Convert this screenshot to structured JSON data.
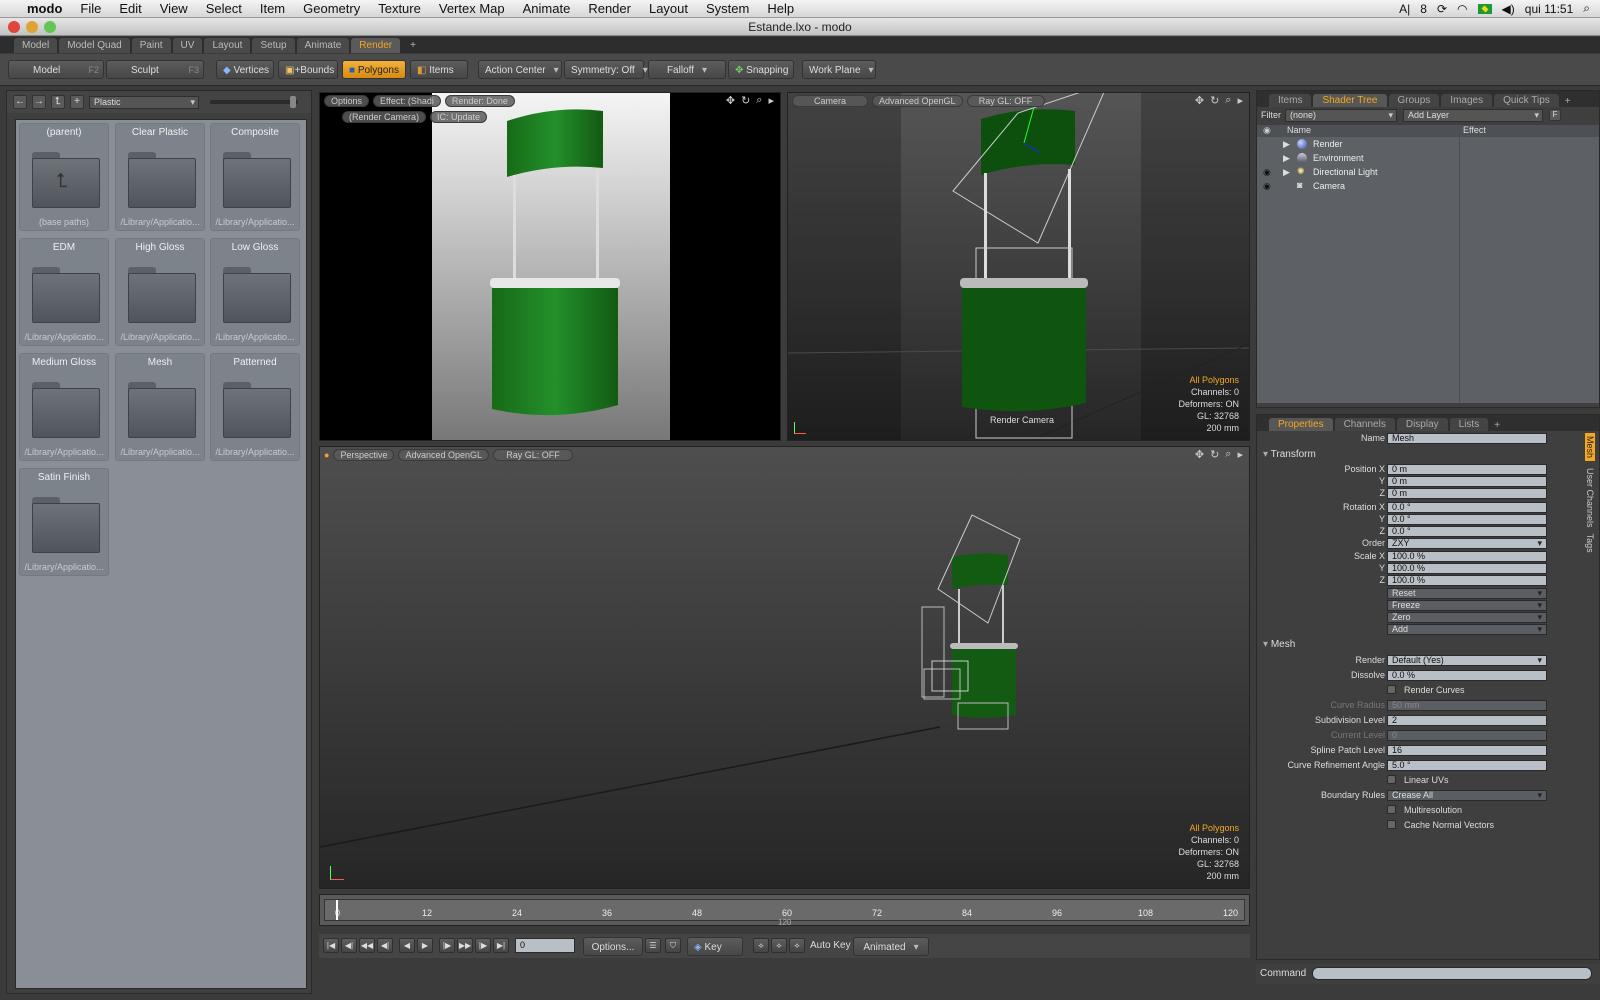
{
  "menubar": {
    "app": "modo",
    "items": [
      "File",
      "Edit",
      "View",
      "Select",
      "Item",
      "Geometry",
      "Texture",
      "Vertex Map",
      "Animate",
      "Render",
      "Layout",
      "System",
      "Help"
    ],
    "status": {
      "battery_num": "8",
      "clock": "qui 11:51"
    }
  },
  "window": {
    "title": "Estande.lxo - modo"
  },
  "layout_tabs": [
    "Model",
    "Model Quad",
    "Paint",
    "UV",
    "Layout",
    "Setup",
    "Animate",
    "Render"
  ],
  "toolbar": {
    "model": "Model",
    "model_key": "F2",
    "sculpt": "Sculpt",
    "sculpt_key": "F3",
    "vertices": "Vertices",
    "bounds": "+Bounds",
    "polygons": "Polygons",
    "items": "Items",
    "action_center": "Action Center",
    "symmetry": "Symmetry: Off",
    "falloff": "Falloff",
    "snapping": "Snapping",
    "work_plane": "Work Plane"
  },
  "presets": {
    "category": "Plastic",
    "tiles": [
      {
        "title": "(parent)",
        "path": "(base paths)"
      },
      {
        "title": "Clear Plastic",
        "path": "/Library/Applicatio..."
      },
      {
        "title": "Composite",
        "path": "/Library/Applicatio..."
      },
      {
        "title": "EDM",
        "path": "/Library/Applicatio..."
      },
      {
        "title": "High Gloss",
        "path": "/Library/Applicatio..."
      },
      {
        "title": "Low Gloss",
        "path": "/Library/Applicatio..."
      },
      {
        "title": "Medium Gloss",
        "path": "/Library/Applicatio..."
      },
      {
        "title": "Mesh",
        "path": "/Library/Applicatio..."
      },
      {
        "title": "Patterned",
        "path": "/Library/Applicatio..."
      },
      {
        "title": "Satin Finish",
        "path": "/Library/Applicatio..."
      }
    ]
  },
  "render_view": {
    "options": "Options",
    "effect": "Effect: (Shadi",
    "render_done": "Render: Done",
    "render_camera": "(Render Camera)",
    "ic_update": "IC: Update"
  },
  "camera_view": {
    "camera": "Camera",
    "opengl": "Advanced OpenGL",
    "raygl": "Ray GL: OFF",
    "cam_label": "Render Camera"
  },
  "persp_view": {
    "mode": "Perspective",
    "opengl": "Advanced OpenGL",
    "raygl": "Ray GL: OFF"
  },
  "stats": {
    "polys": "All Polygons",
    "channels": "Channels: 0",
    "deformers": "Deformers: ON",
    "gl": "GL: 32768",
    "size": "200 mm"
  },
  "shader_panel": {
    "tabs": [
      "Items",
      "Shader Tree",
      "Groups",
      "Images",
      "Quick Tips"
    ],
    "filter_label": "Filter",
    "filter_value": "(none)",
    "add_layer": "Add Layer",
    "col_name": "Name",
    "col_effect": "Effect",
    "items": [
      "Render",
      "Environment",
      "Directional Light",
      "Camera"
    ]
  },
  "properties": {
    "tabs": [
      "Properties",
      "Channels",
      "Display",
      "Lists"
    ],
    "side_tabs": [
      "Mesh",
      "User Channels",
      "Tags"
    ],
    "name_label": "Name",
    "name_value": "Mesh",
    "transform_section": "Transform",
    "pos_label": "Position X",
    "y": "Y",
    "z": "Z",
    "pos_x": "0 m",
    "pos_y": "0 m",
    "pos_z": "0 m",
    "rot_label": "Rotation X",
    "rot_x": "0.0 °",
    "rot_y": "0.0 °",
    "rot_z": "0.0 °",
    "order_label": "Order",
    "order_value": "ZXY",
    "scale_label": "Scale X",
    "scale_x": "100.0 %",
    "scale_y": "100.0 %",
    "scale_z": "100.0 %",
    "reset": "Reset",
    "freeze": "Freeze",
    "zero": "Zero",
    "add": "Add",
    "mesh_section": "Mesh",
    "render_label": "Render",
    "render_value": "Default (Yes)",
    "dissolve_label": "Dissolve",
    "dissolve_value": "0.0 %",
    "render_curves": "Render Curves",
    "curve_radius_label": "Curve Radius",
    "curve_radius_value": "50 mm",
    "subdiv_label": "Subdivision Level",
    "subdiv_value": "2",
    "current_label": "Current Level",
    "current_value": "0",
    "spline_label": "Spline Patch Level",
    "spline_value": "16",
    "refine_label": "Curve Refinement Angle",
    "refine_value": "5.0 °",
    "linear_uvs": "Linear UVs",
    "boundary_label": "Boundary Rules",
    "boundary_value": "Crease All",
    "multires": "Multiresolution",
    "cache_normals": "Cache Normal Vectors"
  },
  "timeline": {
    "ticks": [
      "0",
      "12",
      "24",
      "36",
      "48",
      "60",
      "72",
      "84",
      "96",
      "108",
      "120"
    ],
    "sub": "120"
  },
  "transport": {
    "frame": "0",
    "options": "Options...",
    "key": "Key",
    "auto_key": "Auto Key",
    "animated": "Animated"
  },
  "command": {
    "label": "Command"
  },
  "colors": {
    "accent": "#f5a623",
    "booth_green": "#1f7a1f"
  }
}
